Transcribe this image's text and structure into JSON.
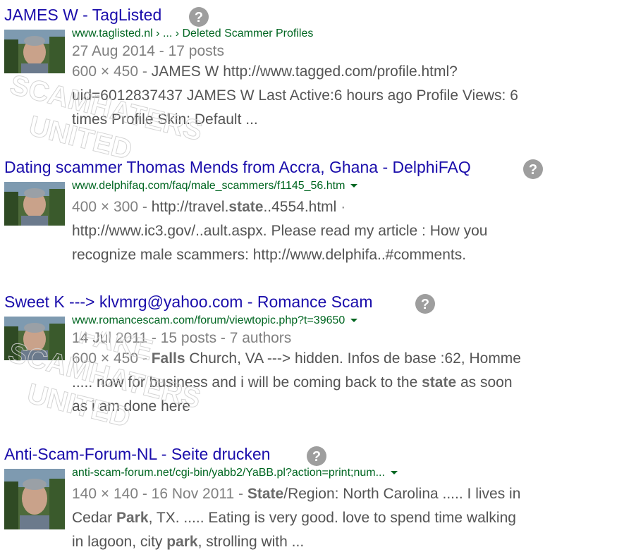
{
  "results": [
    {
      "title": "JAMES W - TagListed",
      "url": "www.taglisted.nl › ... › Deleted Scammer Profiles",
      "meta": "27 Aug 2014 - 17 posts",
      "size": "600 × 450",
      "snippet1": "JAMES W http://www.tagged.com/profile.html?",
      "snippet2": "uid=6012837437 JAMES W Last Active:6 hours ago Profile Views: 6",
      "snippet3": "times Profile Skin: Default ..."
    },
    {
      "title": "Dating scammer Thomas Mends from Accra, Ghana - DelphiFAQ",
      "url": "www.delphifaq.com/faq/male_scammers/f1145_56.htm",
      "size": "400 × 300",
      "snippet1_a": "http://travel.",
      "snippet1_b": "state",
      "snippet1_c": "..4554.html",
      "snippet2": "http://www.ic3.gov/..ault.aspx. Please read my article : How you",
      "snippet3": "recognize male scammers: http://www.delphifa..#comments."
    },
    {
      "title": "Sweet K ---> klvmrg@yahoo.com - Romance Scam",
      "url": "www.romancescam.com/forum/viewtopic.php?t=39650",
      "meta": "14 Jul 2011 - 15 posts - 7 authors",
      "size": "600 × 450",
      "snippet1_a": "Falls",
      "snippet1_b": " Church, VA ---> hidden. Infos de base :62, Homme",
      "snippet2_a": "..... now for business and i will be coming back to the ",
      "snippet2_b": "state",
      "snippet2_c": " as soon",
      "snippet3": "as i am done here"
    },
    {
      "title": "Anti-Scam-Forum-NL - Seite drucken",
      "url": "anti-scam-forum.net/cgi-bin/yabb2/YaBB.pl?action=print;num...",
      "size": "140 × 140 - 16 Nov 2011",
      "snippet1_a": "State",
      "snippet1_b": "/Region: North Carolina ..... I lives in",
      "snippet2_a": "Cedar ",
      "snippet2_b": "Park",
      "snippet2_c": ", TX. ..... Eating is very good. love to spend time walking",
      "snippet3_a": "in lagoon, city ",
      "snippet3_b": "park",
      "snippet3_c": ", strolling with ..."
    }
  ],
  "separator": " - ",
  "dot_separator": "·",
  "watermark": {
    "line1": "SCAMHATERS",
    "line2": "UNITED",
    "line3": "FAKE"
  },
  "colors": {
    "title": "#1a0dab",
    "url": "#006621",
    "meta": "#808080",
    "snippet": "#545454"
  }
}
